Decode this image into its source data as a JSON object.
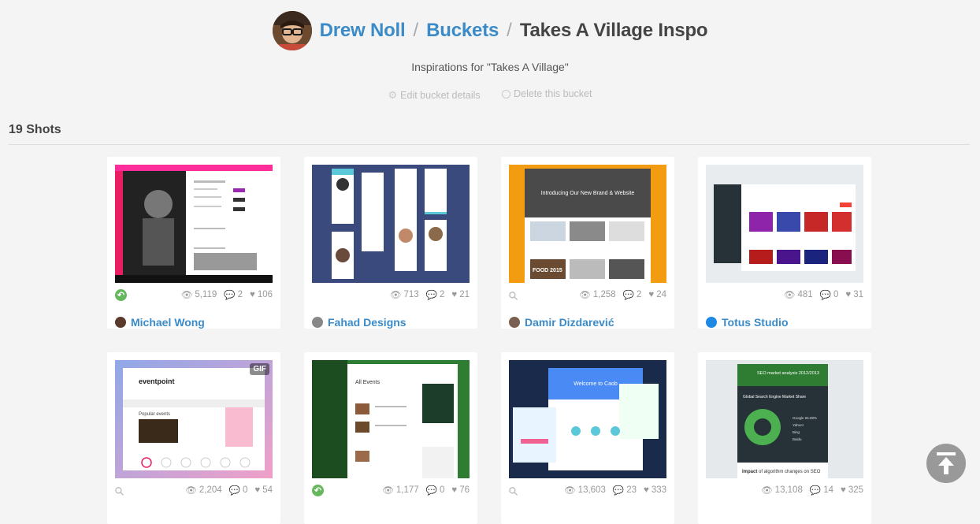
{
  "header": {
    "owner": "Drew Noll",
    "section": "Buckets",
    "bucket": "Takes A Village Inspo",
    "separator": "/",
    "description": "Inspirations for \"Takes A Village\""
  },
  "actions": {
    "edit_label": "Edit bucket details",
    "delete_label": "Delete this bucket"
  },
  "shots_count_label": "19 Shots",
  "shots": [
    {
      "views": "5,119",
      "comments": "2",
      "likes": "106",
      "author": "Michael Wong",
      "source": "rebound"
    },
    {
      "views": "713",
      "comments": "2",
      "likes": "21",
      "author": "Fahad Designs",
      "source": "none"
    },
    {
      "views": "1,258",
      "comments": "2",
      "likes": "24",
      "author": "Damir Dizdarević",
      "source": "link"
    },
    {
      "views": "481",
      "comments": "0",
      "likes": "31",
      "author": "Totus Studio",
      "source": "none"
    },
    {
      "views": "2,204",
      "comments": "0",
      "likes": "54",
      "author": "",
      "source": "link",
      "gif": "GIF"
    },
    {
      "views": "1,177",
      "comments": "0",
      "likes": "76",
      "author": "",
      "source": "rebound"
    },
    {
      "views": "13,603",
      "comments": "23",
      "likes": "333",
      "author": "",
      "source": "link"
    },
    {
      "views": "13,108",
      "comments": "14",
      "likes": "325",
      "author": "",
      "source": "none"
    }
  ],
  "thumb_text": {
    "s3_title": "Introducing Our New Brand & Website",
    "s3_food": "FOOD 2015",
    "s5_brand": "eventpoint",
    "s5_popular": "Popular events",
    "s6_title": "All Events",
    "s7_title": "Welcome to Caob",
    "s8_title": "SEO market analysis 2012/2013",
    "s8_sub": "Global Search Engine Market Share",
    "s8_legend": [
      "Google 65.88%",
      "Yahoo!",
      "Bing",
      "Baidu"
    ],
    "s8_footer_bold": "Impact",
    "s8_footer": " of algorithm changes on SEO"
  },
  "colors": {
    "link": "#3a8bc8",
    "rebound": "#66b85e",
    "background": "#f4f4f4"
  }
}
